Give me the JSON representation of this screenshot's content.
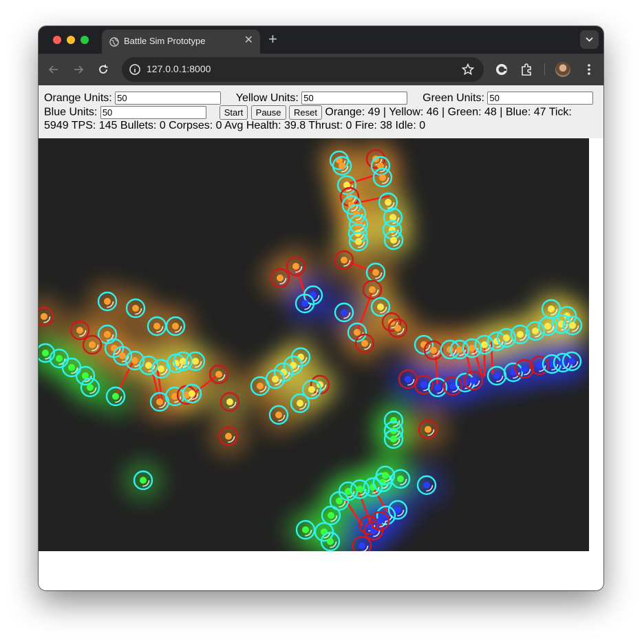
{
  "browser": {
    "tab_title": "Battle Sim Prototype",
    "url": "127.0.0.1:8000"
  },
  "controls": {
    "orange_label": "Orange Units:",
    "orange_value": "50",
    "yellow_label": "Yellow Units:",
    "yellow_value": "50",
    "green_label": "Green Units:",
    "green_value": "50",
    "blue_label": "Blue Units:",
    "blue_value": "50",
    "start_label": "Start",
    "pause_label": "Pause",
    "reset_label": "Reset"
  },
  "stats": {
    "line1": "Orange: 49 | Yellow: 46 | Green: 48 | Blue: 47 Tick:",
    "line2": "5949 TPS: 145 Bullets: 0 Corpses: 0 Avg Health: 39.8 Thrust: 0 Fire: 38 Idle: 0"
  },
  "colors": {
    "orange": "#ff9d2e",
    "yellow": "#ffe94a",
    "green": "#3dff3d",
    "blue": "#2a3cff",
    "ring": "#2ef2f2",
    "enemy_ring": "#cc1a1a",
    "laser": "#ff1a1a",
    "arena_bg": "#222222"
  }
}
